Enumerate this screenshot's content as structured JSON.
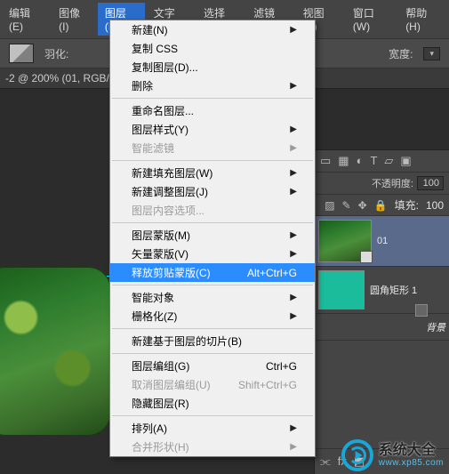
{
  "menubar": {
    "items": [
      {
        "label": "编辑(E)"
      },
      {
        "label": "图像(I)"
      },
      {
        "label": "图层(L)"
      },
      {
        "label": "文字(Y)"
      },
      {
        "label": "选择(S)"
      },
      {
        "label": "滤镜(T)"
      },
      {
        "label": "视图(V)"
      },
      {
        "label": "窗口(W)"
      },
      {
        "label": "帮助(H)"
      }
    ],
    "active_index": 2
  },
  "optbar": {
    "feather_label": "羽化:",
    "width_label": "宽度:"
  },
  "tabbar": {
    "tab_title": "-2 @ 200% (01, RGB/"
  },
  "dropdown": {
    "items": [
      {
        "label": "新建(N)",
        "submenu": true
      },
      {
        "label": "复制 CSS"
      },
      {
        "label": "复制图层(D)..."
      },
      {
        "label": "删除",
        "submenu": true
      },
      {
        "sep": true
      },
      {
        "label": "重命名图层..."
      },
      {
        "label": "图层样式(Y)",
        "submenu": true
      },
      {
        "label": "智能滤镜",
        "submenu": true,
        "disabled": true
      },
      {
        "sep": true
      },
      {
        "label": "新建填充图层(W)",
        "submenu": true
      },
      {
        "label": "新建调整图层(J)",
        "submenu": true
      },
      {
        "label": "图层内容选项...",
        "disabled": true
      },
      {
        "sep": true
      },
      {
        "label": "图层蒙版(M)",
        "submenu": true
      },
      {
        "label": "矢量蒙版(V)",
        "submenu": true
      },
      {
        "label": "释放剪贴蒙版(C)",
        "shortcut": "Alt+Ctrl+G",
        "highlight": true
      },
      {
        "sep": true
      },
      {
        "label": "智能对象",
        "submenu": true
      },
      {
        "label": "栅格化(Z)",
        "submenu": true
      },
      {
        "sep": true
      },
      {
        "label": "新建基于图层的切片(B)"
      },
      {
        "sep": true
      },
      {
        "label": "图层编组(G)",
        "shortcut": "Ctrl+G"
      },
      {
        "label": "取消图层编组(U)",
        "shortcut": "Shift+Ctrl+G",
        "disabled": true
      },
      {
        "label": "隐藏图层(R)"
      },
      {
        "sep": true
      },
      {
        "label": "排列(A)",
        "submenu": true
      },
      {
        "label": "合并形状(H)",
        "submenu": true,
        "disabled": true
      }
    ]
  },
  "layers_panel": {
    "opacity_label": "不透明度:",
    "opacity_value": "100",
    "fill_label": "填充:",
    "fill_value": "100",
    "layers": [
      {
        "name": "01",
        "thumb": "jungle",
        "selected": true
      },
      {
        "name": "圆角矩形 1",
        "thumb": "teal"
      },
      {
        "name": "背景",
        "thumb": "bg"
      }
    ]
  },
  "watermark": {
    "title": "系统大全",
    "url": "www.xp85.com"
  }
}
